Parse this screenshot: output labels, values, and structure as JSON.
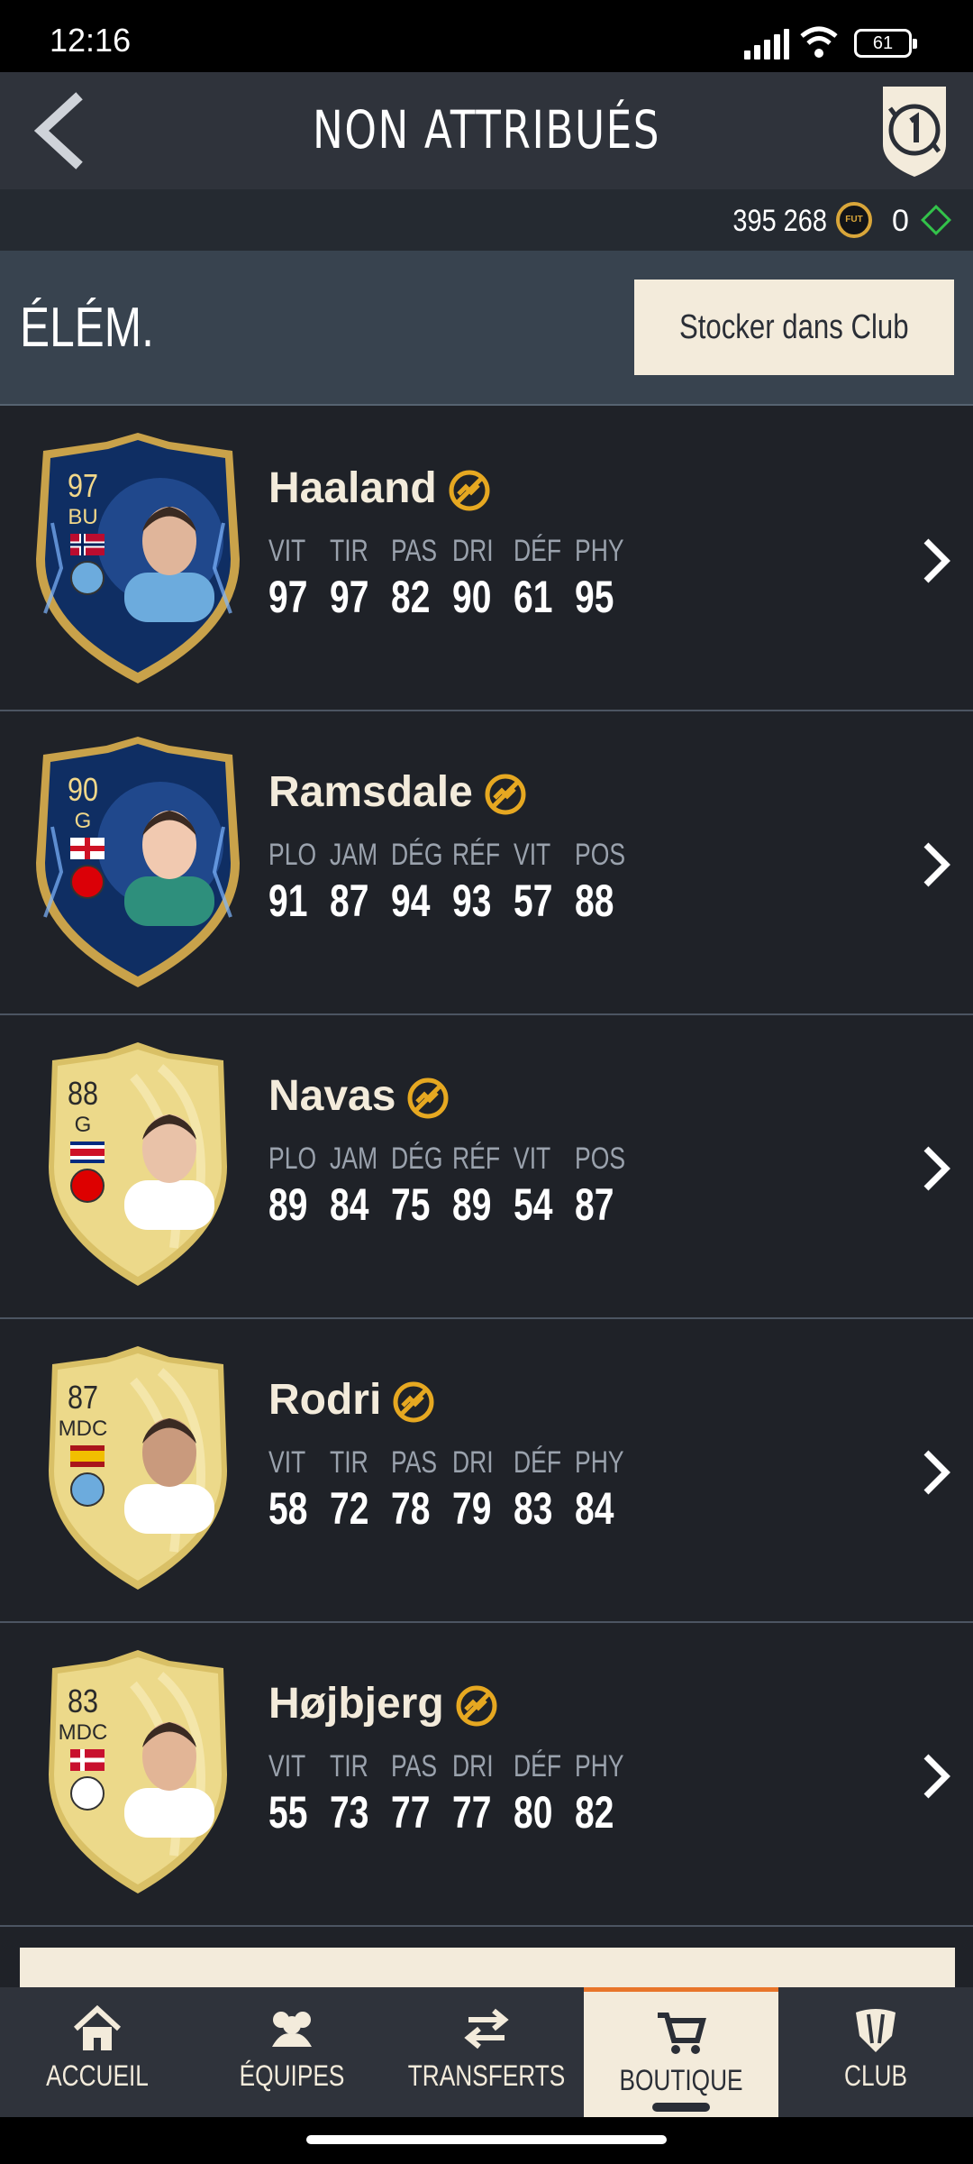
{
  "status_bar": {
    "time": "12:16",
    "battery": "61"
  },
  "header": {
    "title": "NON ATTRIBUÉS"
  },
  "currency": {
    "coins": "395 268",
    "fut_icon": "FUT",
    "points": "0"
  },
  "section": {
    "title": "ÉLÉM.",
    "store_button": "Stocker dans Club"
  },
  "players": [
    {
      "name": "Haaland",
      "rating": "97",
      "position": "BU",
      "card": "tots",
      "flag": "norway",
      "club": "man-city",
      "stats": [
        {
          "label": "VIT",
          "value": "97"
        },
        {
          "label": "TIR",
          "value": "97"
        },
        {
          "label": "PAS",
          "value": "82"
        },
        {
          "label": "DRI",
          "value": "90"
        },
        {
          "label": "DÉF",
          "value": "61"
        },
        {
          "label": "PHY",
          "value": "95"
        }
      ]
    },
    {
      "name": "Ramsdale",
      "rating": "90",
      "position": "G",
      "card": "tots",
      "flag": "england",
      "club": "arsenal",
      "stats": [
        {
          "label": "PLO",
          "value": "91"
        },
        {
          "label": "JAM",
          "value": "87"
        },
        {
          "label": "DÉG",
          "value": "94"
        },
        {
          "label": "RÉF",
          "value": "93"
        },
        {
          "label": "VIT",
          "value": "57"
        },
        {
          "label": "POS",
          "value": "88"
        }
      ]
    },
    {
      "name": "Navas",
      "rating": "88",
      "position": "G",
      "card": "gold",
      "flag": "costa-rica",
      "club": "nottingham-forest",
      "stats": [
        {
          "label": "PLO",
          "value": "89"
        },
        {
          "label": "JAM",
          "value": "84"
        },
        {
          "label": "DÉG",
          "value": "75"
        },
        {
          "label": "RÉF",
          "value": "89"
        },
        {
          "label": "VIT",
          "value": "54"
        },
        {
          "label": "POS",
          "value": "87"
        }
      ]
    },
    {
      "name": "Rodri",
      "rating": "87",
      "position": "MDC",
      "card": "gold",
      "flag": "spain",
      "club": "man-city",
      "stats": [
        {
          "label": "VIT",
          "value": "58"
        },
        {
          "label": "TIR",
          "value": "72"
        },
        {
          "label": "PAS",
          "value": "78"
        },
        {
          "label": "DRI",
          "value": "79"
        },
        {
          "label": "DÉF",
          "value": "83"
        },
        {
          "label": "PHY",
          "value": "84"
        }
      ]
    },
    {
      "name": "Højbjerg",
      "rating": "83",
      "position": "MDC",
      "card": "gold",
      "flag": "denmark",
      "club": "tottenham",
      "stats": [
        {
          "label": "VIT",
          "value": "55"
        },
        {
          "label": "TIR",
          "value": "73"
        },
        {
          "label": "PAS",
          "value": "77"
        },
        {
          "label": "DRI",
          "value": "77"
        },
        {
          "label": "DÉF",
          "value": "80"
        },
        {
          "label": "PHY",
          "value": "82"
        }
      ]
    }
  ],
  "nav": [
    {
      "label": "ACCUEIL",
      "icon": "home-icon"
    },
    {
      "label": "ÉQUIPES",
      "icon": "team-icon"
    },
    {
      "label": "TRANSFERTS",
      "icon": "transfer-icon"
    },
    {
      "label": "BOUTIQUE",
      "icon": "cart-icon",
      "active": true
    },
    {
      "label": "CLUB",
      "icon": "club-icon"
    }
  ],
  "colors": {
    "accent": "#e8752a",
    "cream": "#f3ebdb",
    "gold_badge": "#e6a821",
    "background": "#1f2228"
  }
}
